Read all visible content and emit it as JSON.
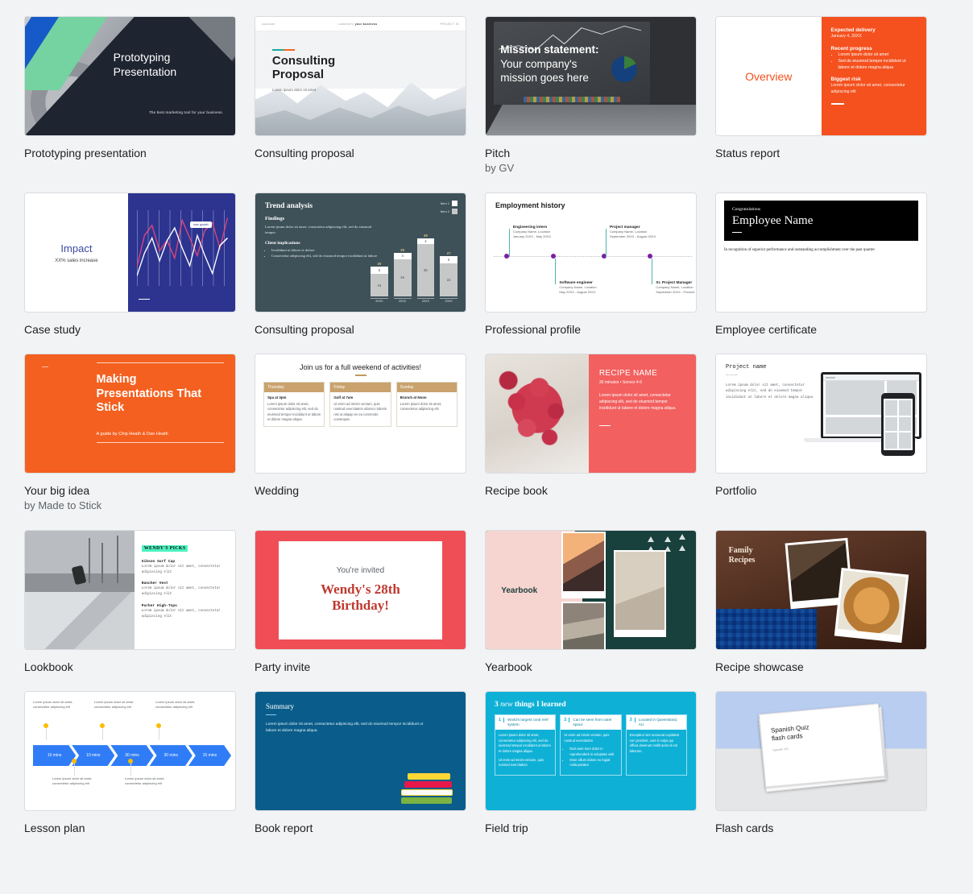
{
  "gallery": {
    "cards": [
      {
        "id": "prototyping-presentation",
        "title": "Prototyping presentation",
        "byline": "",
        "slide": {
          "heading": "Prototyping\nPresentation",
          "tagline": "The best marketing tool for your business."
        }
      },
      {
        "id": "consulting-proposal",
        "title": "Consulting proposal",
        "byline": "",
        "slide": {
          "nav_left": "customer",
          "nav_mid_plain": "customer's ",
          "nav_mid_bold": "your business",
          "nav_right": "PROJECT ID",
          "heading": "Consulting\nProposal",
          "sub": "Lorem ipsum dolor sit amet."
        }
      },
      {
        "id": "pitch",
        "title": "Pitch",
        "byline": "by GV",
        "slide": {
          "heading_bold": "Mission statement:",
          "heading_rest": "Your company's\nmission goes here"
        }
      },
      {
        "id": "status-report",
        "title": "Status report",
        "byline": "",
        "slide": {
          "left_label": "Overview",
          "s1_title": "Expected delivery",
          "s1_body": "January 4, 20XX",
          "s2_title": "Recent progress",
          "s2_items": [
            "Lorem ipsum dolor sit amet",
            "Sed do eiusmod tempor incididunt ut labore et dolore magna aliqua"
          ],
          "s3_title": "Biggest risk",
          "s3_body": "Lorem ipsum dolor sit amet, consectetur adipiscing elit"
        }
      },
      {
        "id": "case-study",
        "title": "Case study",
        "byline": "",
        "slide": {
          "heading": "Impact",
          "sub": "XX% sales increase",
          "callout": "max growth"
        }
      },
      {
        "id": "consulting-proposal-2",
        "title": "Consulting proposal",
        "byline": "",
        "slide": {
          "heading": "Trend analysis",
          "sub": "Findings",
          "body": "Lorem ipsum dolor sit amet, consectetur adipiscing elit, sed do eiusmod tempor",
          "implications_title": "Client implications",
          "implications": [
            "Incididunt ut labore et dolore",
            "Consectetur adipiscing elit, sed do eiusmod tempor incididunt ut labore"
          ],
          "legend": [
            "Item 1",
            "Item 2"
          ]
        }
      },
      {
        "id": "professional-profile",
        "title": "Professional profile",
        "byline": "",
        "slide": {
          "heading": "Employment history",
          "events": [
            {
              "role": "Engineering intern",
              "org": "Company Name, Location",
              "dates": "January 20XX - May 20XX"
            },
            {
              "role": "Software engineer",
              "org": "Company Name, Location",
              "dates": "May 20XX - August 20XX"
            },
            {
              "role": "Project manager",
              "org": "Company Name, Location",
              "dates": "September 20XX - August 20XX"
            },
            {
              "role": "Sr. Project Manager",
              "org": "Company Name, Location",
              "dates": "September 20XX - Present"
            }
          ]
        }
      },
      {
        "id": "employee-certificate",
        "title": "Employee certificate",
        "byline": "",
        "slide": {
          "eyebrow": "Congratulations",
          "name": "Employee Name",
          "body": "In recognition of superior performance and outstanding accomplishment over the past quarter"
        }
      },
      {
        "id": "your-big-idea",
        "title": "Your big idea",
        "byline": "by Made to Stick",
        "slide": {
          "heading": "Making\nPresentations That\nStick",
          "byline": "A guide by Chip Heath & Dan Heath"
        }
      },
      {
        "id": "wedding",
        "title": "Wedding",
        "byline": "",
        "slide": {
          "heading": "Join us for a full weekend of activities!",
          "columns": [
            {
              "day": "Thursday",
              "event": "Spa at 3pm",
              "body": "Lorem ipsum dolor sit amet, consectetur adipiscing elit, sed do eiusmod tempor incididunt ut labore et dolore magna aliqua."
            },
            {
              "day": "Friday",
              "event": "Golf at 7am",
              "body": "Ut enim ad minim veniam, quis nostrud exercitation ullamco laboris nisi ut aliquip ex ea commodo consequat."
            },
            {
              "day": "Sunday",
              "event": "Brunch at Noon",
              "body": "Lorem ipsum dolor sit amet, consectetur adipiscing elit"
            }
          ]
        }
      },
      {
        "id": "recipe-book",
        "title": "Recipe book",
        "byline": "",
        "slide": {
          "heading": "RECIPE NAME",
          "meta": "30 minutes • Serves 4-6",
          "body": "Lorem ipsum dolor sit amet, consectetur adipiscing elit, sed do eiusmod tempor incididunt ut labore et dolore magna aliqua."
        }
      },
      {
        "id": "portfolio",
        "title": "Portfolio",
        "byline": "",
        "slide": {
          "heading": "Project name",
          "rule": "———",
          "body": "Lorem ipsum dolor sit amet, consectetur adipiscing elit, sed do eiusmod tempor incididunt ut labore et dolore magna aliqua"
        }
      },
      {
        "id": "lookbook",
        "title": "Lookbook",
        "byline": "",
        "slide": {
          "badge": "WENDY'S PICKS",
          "items": [
            {
              "name": "Gibson Surf Cap",
              "body": "Lorem ipsum dolor sit amet, consectetur adipiscing elit"
            },
            {
              "name": "Rancher Vest",
              "body": "Lorem ipsum dolor sit amet, consectetur adipiscing elit"
            },
            {
              "name": "Parker High-Tops",
              "body": "Lorem ipsum dolor sit amet, consectetur adipiscing elit"
            }
          ]
        }
      },
      {
        "id": "party-invite",
        "title": "Party invite",
        "byline": "",
        "slide": {
          "line1": "You're invited",
          "line2": "Wendy's 28th\nBirthday!"
        }
      },
      {
        "id": "yearbook",
        "title": "Yearbook",
        "byline": "",
        "slide": {
          "heading": "Yearbook"
        }
      },
      {
        "id": "recipe-showcase",
        "title": "Recipe showcase",
        "byline": "",
        "slide": {
          "heading": "Family\nRecipes"
        }
      },
      {
        "id": "lesson-plan",
        "title": "Lesson plan",
        "byline": "",
        "slide": {
          "segments": [
            "10 mins",
            "10 mins",
            "30 mins",
            "30 mins",
            "15 mins"
          ],
          "notes_top": [
            "Lorem ipsum dolor sit amet, consectetur adipiscing elit",
            "Lorem ipsum dolor sit amet, consectetur adipiscing elit",
            "Lorem ipsum dolor sit amet, consectetur adipiscing elit"
          ],
          "notes_bottom": [
            "Lorem ipsum dolor sit amet, consectetur adipiscing elit",
            "Lorem ipsum dolor sit amet, consectetur adipiscing elit"
          ]
        }
      },
      {
        "id": "book-report",
        "title": "Book report",
        "byline": "",
        "slide": {
          "heading": "Summary",
          "body": "Lorem ipsum dolor sit amet, consectetur adipiscing elit, sed do eiusmod tempor incididunt ut labore et dolore magna aliqua."
        }
      },
      {
        "id": "field-trip",
        "title": "Field trip",
        "byline": "",
        "slide": {
          "heading_pre": "3 ",
          "heading_em": "new",
          "heading_post": " things I learned",
          "columns": [
            {
              "n": "1",
              "title": "World's largest coral reef system",
              "p1": "Lorem ipsum dolor sit amet, consectetur adipiscing elit, sed do eiusmod tempor incididunt ut labore et dolore magna aliqua.",
              "p2": "Ut enim ad minim veniam, quis nostrud exercitation",
              "bullets": []
            },
            {
              "n": "2",
              "title": "Can be seen from outer space",
              "p1": "Ut enim ad minim veniam, quis nostrud exercitation",
              "p2": "",
              "bullets": [
                "Duis aute irure dolor in reprehenderit in voluptate velit",
                "Esse cillum dolore eu fugiat nulla pariatur"
              ]
            },
            {
              "n": "3",
              "title": "Located in Queensland, AU",
              "p1": "Excepteur sint occaecat cupidatat non proident, sunt in culpa qui officia deserunt mollit anim id est laborum.",
              "p2": "",
              "bullets": []
            }
          ]
        }
      },
      {
        "id": "flash-cards",
        "title": "Flash cards",
        "byline": "",
        "slide": {
          "heading": "Spanish Quiz\nflash cards",
          "sub": "Spanish 101"
        }
      }
    ]
  },
  "chart_data": {
    "type": "bar",
    "title": "Trend analysis",
    "categories": [
      "20XX",
      "20XX",
      "20XX",
      "20XX"
    ],
    "totals": [
      20,
      29,
      39,
      27
    ],
    "series": [
      {
        "name": "Item 2",
        "values": [
          15,
          25,
          35,
          22
        ],
        "color": "#c6c8c8"
      },
      {
        "name": "Item 1",
        "values": [
          5,
          4,
          4,
          5
        ],
        "color": "#ffffff"
      }
    ],
    "xlabel": "",
    "ylabel": "",
    "ylim": [
      0,
      42
    ],
    "grid": false,
    "legend_position": "top-right",
    "stacked": true
  }
}
